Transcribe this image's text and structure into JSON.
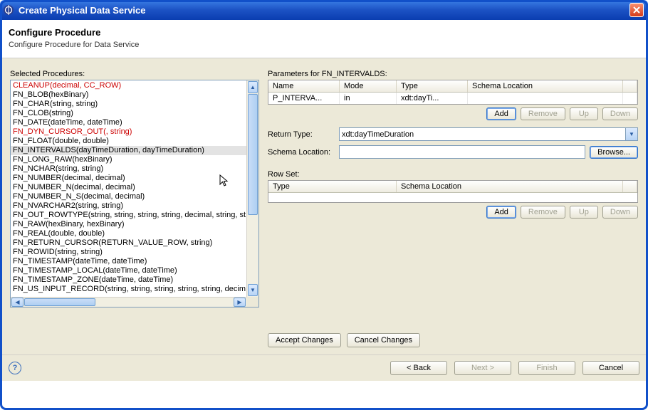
{
  "window": {
    "title": "Create Physical Data Service"
  },
  "header": {
    "title": "Configure Procedure",
    "subtitle": "Configure Procedure for Data Service"
  },
  "left": {
    "label": "Selected Procedures:",
    "items": [
      {
        "text": "CLEANUP(decimal, CC_ROW)",
        "red": true
      },
      {
        "text": "FN_BLOB(hexBinary)"
      },
      {
        "text": "FN_CHAR(string, string)"
      },
      {
        "text": "FN_CLOB(string)"
      },
      {
        "text": "FN_DATE(dateTime, dateTime)"
      },
      {
        "text": "FN_DYN_CURSOR_OUT(, string)",
        "red": true
      },
      {
        "text": "FN_FLOAT(double, double)"
      },
      {
        "text": "FN_INTERVALDS(dayTimeDuration, dayTimeDuration)",
        "selected": true
      },
      {
        "text": "FN_LONG_RAW(hexBinary)"
      },
      {
        "text": "FN_NCHAR(string, string)"
      },
      {
        "text": "FN_NUMBER(decimal, decimal)"
      },
      {
        "text": "FN_NUMBER_N(decimal, decimal)"
      },
      {
        "text": "FN_NUMBER_N_S(decimal, decimal)"
      },
      {
        "text": "FN_NVARCHAR2(string, string)"
      },
      {
        "text": "FN_OUT_ROWTYPE(string, string, string, string, decimal, string, st"
      },
      {
        "text": "FN_RAW(hexBinary, hexBinary)"
      },
      {
        "text": "FN_REAL(double, double)"
      },
      {
        "text": "FN_RETURN_CURSOR(RETURN_VALUE_ROW, string)"
      },
      {
        "text": "FN_ROWID(string, string)"
      },
      {
        "text": "FN_TIMESTAMP(dateTime, dateTime)"
      },
      {
        "text": "FN_TIMESTAMP_LOCAL(dateTime, dateTime)"
      },
      {
        "text": "FN_TIMESTAMP_ZONE(dateTime, dateTime)"
      },
      {
        "text": "FN_US_INPUT_RECORD(string, string, string, string, string, decim"
      }
    ]
  },
  "params": {
    "label": "Parameters for FN_INTERVALDS:",
    "cols": {
      "name": "Name",
      "mode": "Mode",
      "type": "Type",
      "schema": "Schema Location"
    },
    "row": {
      "name": "P_INTERVA...",
      "mode": "in",
      "type": "xdt:dayTi..."
    },
    "buttons": {
      "add": "Add",
      "remove": "Remove",
      "up": "Up",
      "down": "Down"
    }
  },
  "ret": {
    "label": "Return Type:",
    "value": "xdt:dayTimeDuration",
    "schema_label": "Schema Location:",
    "browse": "Browse..."
  },
  "rowset": {
    "label": "Row Set:",
    "cols": {
      "type": "Type",
      "schema": "Schema Location"
    },
    "buttons": {
      "add": "Add",
      "remove": "Remove",
      "up": "Up",
      "down": "Down"
    }
  },
  "changes": {
    "accept": "Accept Changes",
    "cancel": "Cancel Changes"
  },
  "footer": {
    "back": "< Back",
    "next": "Next >",
    "finish": "Finish",
    "cancel": "Cancel"
  }
}
